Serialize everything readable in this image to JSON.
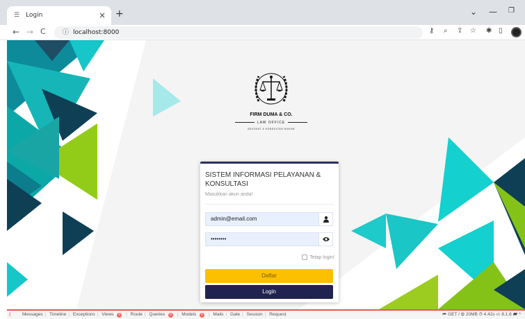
{
  "browser": {
    "tab_title": "Login",
    "tab_close": "×",
    "new_tab": "+",
    "url": "localhost:8000",
    "nav_back": "←",
    "nav_forward": "→",
    "nav_reload": "C"
  },
  "brand": {
    "firm_name": "FIRM DUMA & CO.",
    "law_office": "LAW OFFICE",
    "tagline": "ADVOKAT & KONSULTAN HUKUM"
  },
  "login": {
    "title": "SISTEM INFORMASI PELAYANAN & KONSULTASI",
    "subtitle": "Masukkan akun anda!",
    "email_value": "admin@email.com",
    "password_value": "••••••••",
    "remember_label": "Tetap login!",
    "register_label": "Daftar",
    "login_label": "Login"
  },
  "debugbar": {
    "messages": "Messages",
    "timeline": "Timeline",
    "exceptions": "Exceptions",
    "views": "Views",
    "views_count": "6",
    "route": "Route",
    "queries": "Queries",
    "queries_count": "0",
    "models": "Models",
    "models_count": "0",
    "mails": "Mails",
    "gate": "Gate",
    "session": "Session",
    "request": "Request",
    "method": "GET /",
    "memory": "20MB",
    "time": "4.42s",
    "php": "8.1.6"
  },
  "colors": {
    "navy": "#202250",
    "gold": "#fcc000",
    "teal": "#1fc9c9",
    "green": "#9ccc20"
  }
}
